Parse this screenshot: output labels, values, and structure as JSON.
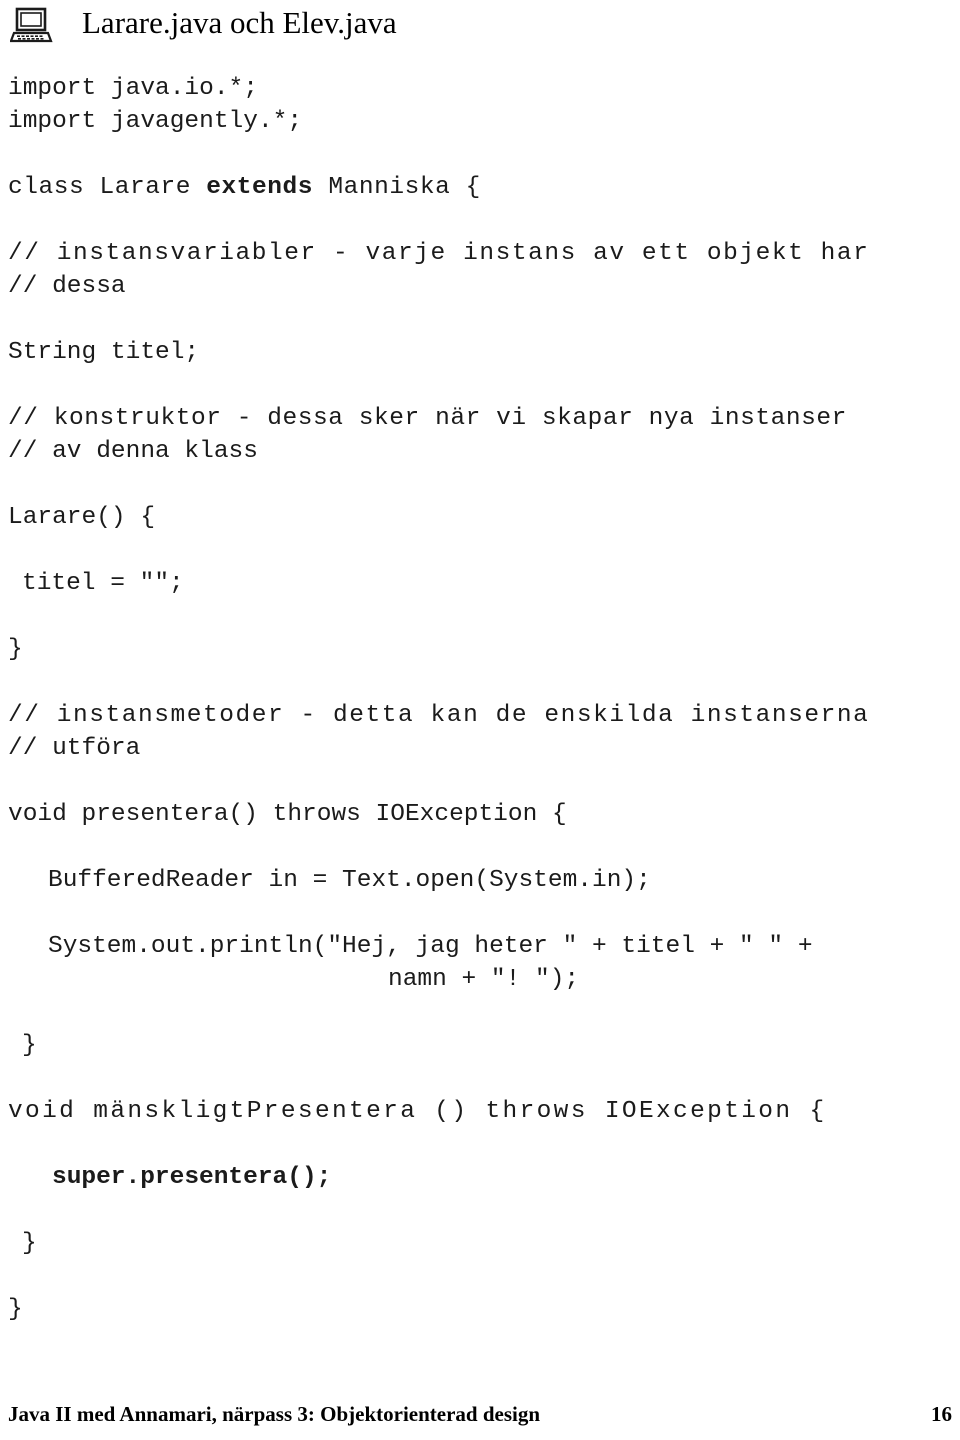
{
  "header": {
    "icon": "laptop-computer-icon",
    "title": "Larare.java och Elev.java"
  },
  "code": {
    "lines": [
      {
        "text": "import java.io.*;",
        "style": "plain",
        "indent": "none"
      },
      {
        "text": "import javagently.*;",
        "style": "plain",
        "indent": "none"
      },
      {
        "text": "",
        "style": "blank",
        "indent": "none"
      },
      {
        "text": "class Larare extends Manniska {",
        "style": "stretch-d",
        "indent": "none",
        "bold_word": "extends"
      },
      {
        "text": "",
        "style": "blank",
        "indent": "none"
      },
      {
        "text": "// instansvariabler - varje instans av ett objekt har",
        "style": "stretch-c",
        "indent": "none"
      },
      {
        "text": "// dessa",
        "style": "plain",
        "indent": "none"
      },
      {
        "text": "",
        "style": "blank",
        "indent": "none"
      },
      {
        "text": "String titel;",
        "style": "plain",
        "indent": "none"
      },
      {
        "text": "",
        "style": "blank",
        "indent": "none"
      },
      {
        "text": "// konstruktor - dessa sker när vi skapar nya instanser",
        "style": "stretch-d",
        "indent": "none"
      },
      {
        "text": "// av denna klass",
        "style": "plain",
        "indent": "none"
      },
      {
        "text": "",
        "style": "blank",
        "indent": "none"
      },
      {
        "text": "Larare() {",
        "style": "plain",
        "indent": "none"
      },
      {
        "text": "",
        "style": "blank",
        "indent": "none"
      },
      {
        "text": "titel = \"\";",
        "style": "plain",
        "indent": "ind-close"
      },
      {
        "text": "",
        "style": "blank",
        "indent": "none"
      },
      {
        "text": "}",
        "style": "plain",
        "indent": "none"
      },
      {
        "text": "",
        "style": "blank",
        "indent": "none"
      },
      {
        "text": "// instansmetoder - detta kan de enskilda instanserna",
        "style": "stretch-c",
        "indent": "none"
      },
      {
        "text": "// utföra",
        "style": "plain",
        "indent": "none"
      },
      {
        "text": "",
        "style": "blank",
        "indent": "none"
      },
      {
        "text": "void presentera() throws IOException {",
        "style": "plain",
        "indent": "none"
      },
      {
        "text": "",
        "style": "blank",
        "indent": "none"
      },
      {
        "text": "BufferedReader in = Text.open(System.in);",
        "style": "plain",
        "indent": "ind1"
      },
      {
        "text": "",
        "style": "blank",
        "indent": "none"
      },
      {
        "text": "System.out.println(\"Hej, jag heter \" + titel + \" \" +",
        "style": "plain",
        "indent": "ind1"
      },
      {
        "text": "namn + \"! \");",
        "style": "plain",
        "indent": "ind-cont"
      },
      {
        "text": "",
        "style": "blank",
        "indent": "none"
      },
      {
        "text": "}",
        "style": "plain",
        "indent": "ind-close"
      },
      {
        "text": "",
        "style": "blank",
        "indent": "none"
      },
      {
        "text": "void mänskligtPresentera () throws IOException {",
        "style": "stretch-b",
        "indent": "none"
      },
      {
        "text": "",
        "style": "blank",
        "indent": "none"
      },
      {
        "text": "super.presentera();",
        "style": "bold",
        "indent": "ind2"
      },
      {
        "text": "",
        "style": "blank",
        "indent": "none"
      },
      {
        "text": "}",
        "style": "plain",
        "indent": "ind-close"
      },
      {
        "text": "",
        "style": "blank",
        "indent": "none"
      },
      {
        "text": "}",
        "style": "plain",
        "indent": "none"
      }
    ]
  },
  "footer": {
    "text": "Java II med Annamari, närpass 3: Objektorienterad design",
    "page": "16"
  },
  "colors": {
    "background": "#ffffff",
    "text": "#000000",
    "code_text": "#1b1b1b"
  }
}
